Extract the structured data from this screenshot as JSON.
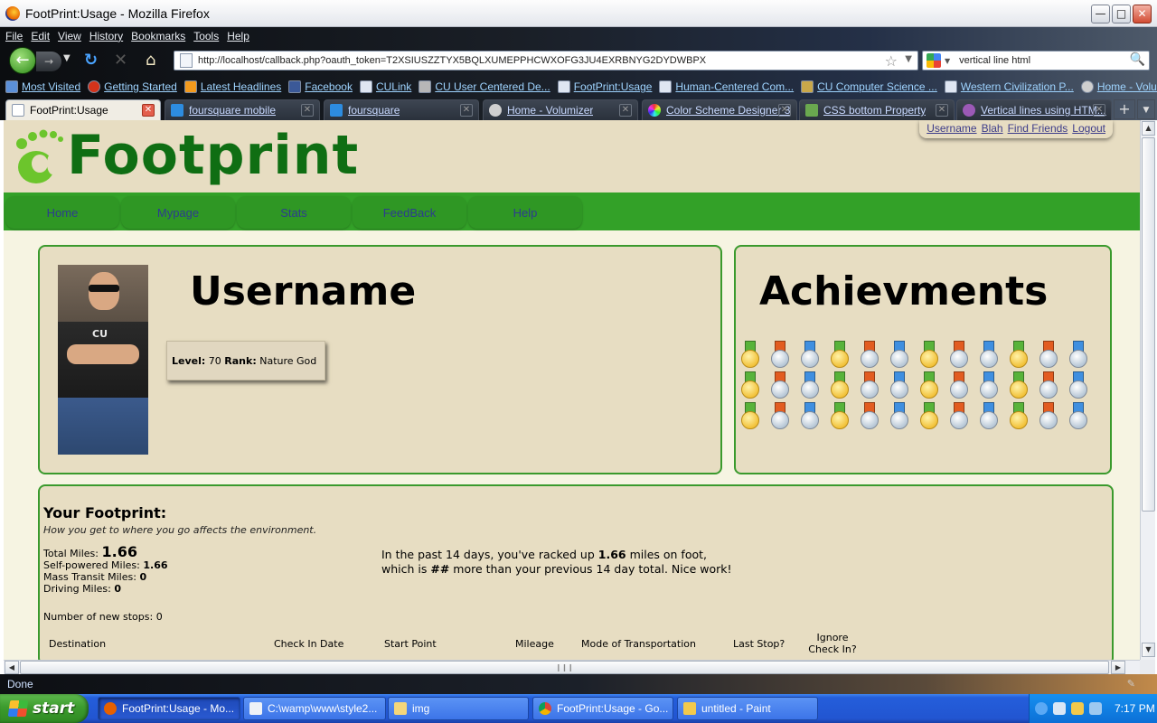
{
  "window": {
    "title": "FootPrint:Usage - Mozilla Firefox",
    "buttons": {
      "minimize": "—",
      "maximize": "□",
      "close": "✕"
    }
  },
  "menu": [
    "File",
    "Edit",
    "View",
    "History",
    "Bookmarks",
    "Tools",
    "Help"
  ],
  "nav": {
    "url": "http://localhost/callback.php?oauth_token=T2XSIUSZZTYX5BQLXUMEPPHCWXOFG3JU4EXRBNYG2DYDWBPX",
    "search_query": "vertical line html"
  },
  "bookmarks": [
    "Most Visited",
    "Getting Started",
    "Latest Headlines",
    "Facebook",
    "CULink",
    "CU User Centered De...",
    "FootPrint:Usage",
    "Human-Centered Com...",
    "CU Computer Science ...",
    "Western Civilization P...",
    "Home - Volumizer"
  ],
  "tabs": [
    "FootPrint:Usage",
    "foursquare mobile",
    "foursquare",
    "Home - Volumizer",
    "Color Scheme Designer 3",
    "CSS bottom Property",
    "Vertical lines using HTM..."
  ],
  "site": {
    "logo_text": "Footprint",
    "user_links": [
      "Username",
      "Blah",
      "Find Friends",
      "Logout"
    ],
    "nav_items": [
      "Home",
      "Mypage",
      "Stats",
      "FeedBack",
      "Help"
    ]
  },
  "profile": {
    "username": "Username",
    "level_label": "Level:",
    "level_value": "70",
    "rank_label": "Rank:",
    "rank_value": "Nature God",
    "photo_shirt_text": "CU"
  },
  "achievements": {
    "title": "Achievments",
    "rows": 3,
    "pattern": [
      {
        "ribbon": "green",
        "disc": "gold"
      },
      {
        "ribbon": "orange",
        "disc": "silver"
      },
      {
        "ribbon": "blue",
        "disc": "silver"
      }
    ],
    "groups_per_row": 4,
    "colors": {
      "green": "#58b33a",
      "orange": "#e25c20",
      "blue": "#3f8fe0"
    }
  },
  "footprint": {
    "title": "Your Footprint:",
    "subtitle": "How you get to where you go affects the environment.",
    "total_label": "Total Miles:",
    "total_value": "1.66",
    "self_label": "Self-powered Miles:",
    "self_value": "1.66",
    "transit_label": "Mass Transit Miles:",
    "transit_value": "0",
    "driving_label": "Driving Miles:",
    "driving_value": "0",
    "summary_pre": "In the past 14 days, you've racked up",
    "summary_miles": "1.66",
    "summary_mid": "miles on foot, which is",
    "summary_hash": "##",
    "summary_post": "more than your previous 14 day total. Nice work!",
    "new_stops": "Number of new stops: 0",
    "columns": [
      "Destination",
      "Check In Date",
      "Start Point",
      "Mileage",
      "Mode of Transportation",
      "Last Stop?",
      "Ignore Check In?"
    ]
  },
  "status": "Done",
  "taskbar": {
    "start": "start",
    "tasks": [
      "FootPrint:Usage - Mo...",
      "C:\\wamp\\www\\style2...",
      "img",
      "FootPrint:Usage - Go...",
      "untitled - Paint"
    ],
    "clock": "7:17 PM"
  },
  "theme": {
    "header_bg": "#e7ddc2",
    "nav_green": "#33a128",
    "logo_green": "#0f6e13",
    "panel_border": "#3a9a2d",
    "link_color": "#3c3c8a"
  }
}
